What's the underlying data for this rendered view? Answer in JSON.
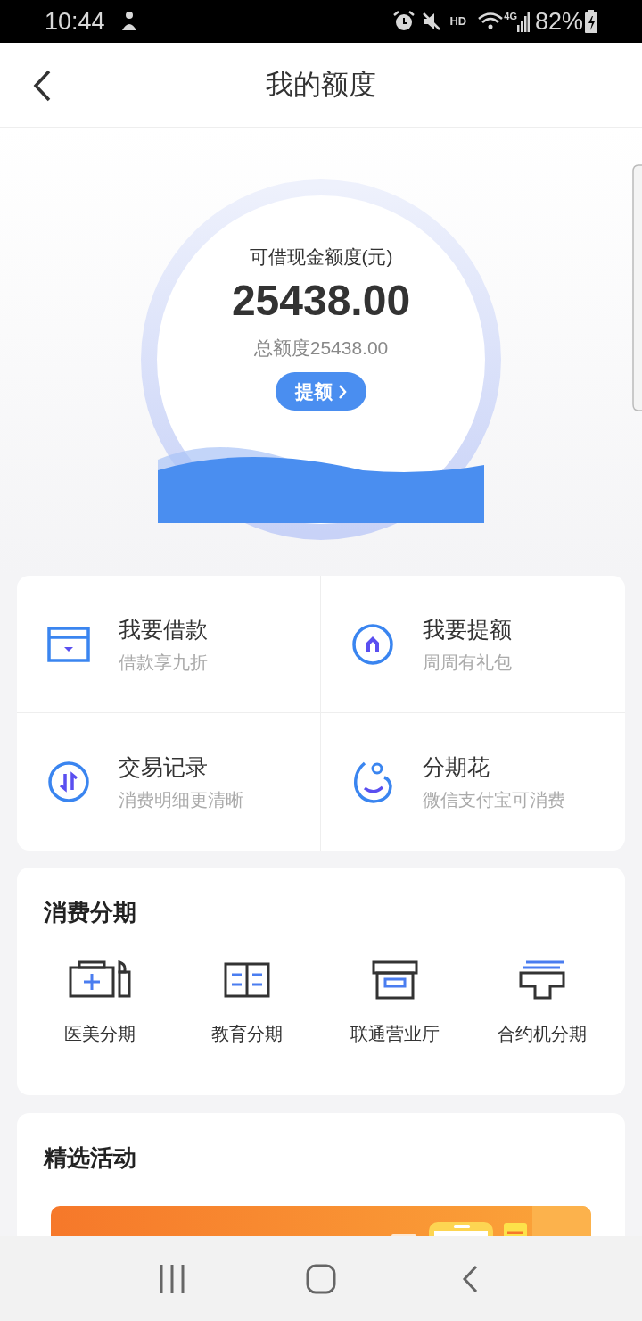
{
  "status_bar": {
    "time": "10:44",
    "hd_label": "HD",
    "network_label": "4G",
    "battery": "82%"
  },
  "header": {
    "title": "我的额度"
  },
  "quota": {
    "label": "可借现金额度(元)",
    "amount": "25438.00",
    "total": "总额度25438.00",
    "button": "提额"
  },
  "shortcuts": [
    {
      "title": "我要借款",
      "subtitle": "借款享九折",
      "kind": "wallet"
    },
    {
      "title": "我要提额",
      "subtitle": "周周有礼包",
      "kind": "raise"
    },
    {
      "title": "交易记录",
      "subtitle": "消费明细更清晰",
      "kind": "records"
    },
    {
      "title": "分期花",
      "subtitle": "微信支付宝可消费",
      "kind": "flower"
    }
  ],
  "installments": {
    "title": "消费分期",
    "items": [
      {
        "label": "医美分期",
        "kind": "medical"
      },
      {
        "label": "教育分期",
        "kind": "education"
      },
      {
        "label": "联通营业厅",
        "kind": "store"
      },
      {
        "label": "合约机分期",
        "kind": "phone"
      }
    ]
  },
  "activities": {
    "title": "精选活动"
  }
}
